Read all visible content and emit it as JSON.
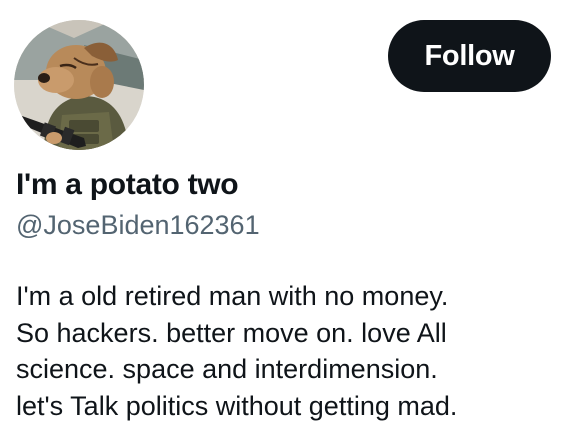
{
  "profile": {
    "display_name": "I'm a potato two",
    "handle": "@JoseBiden162361",
    "avatar_icon": "avatar-image",
    "bio_lines": [
      "I'm a old retired man with no money.",
      "So hackers. better move on. love All",
      "science. space and interdimension.",
      "let's Talk politics without getting mad."
    ]
  },
  "actions": {
    "follow_label": "Follow"
  },
  "colors": {
    "text_primary": "#0f1419",
    "text_secondary": "#536471",
    "button_bg": "#0f1419",
    "button_text": "#ffffff",
    "background": "#ffffff"
  }
}
